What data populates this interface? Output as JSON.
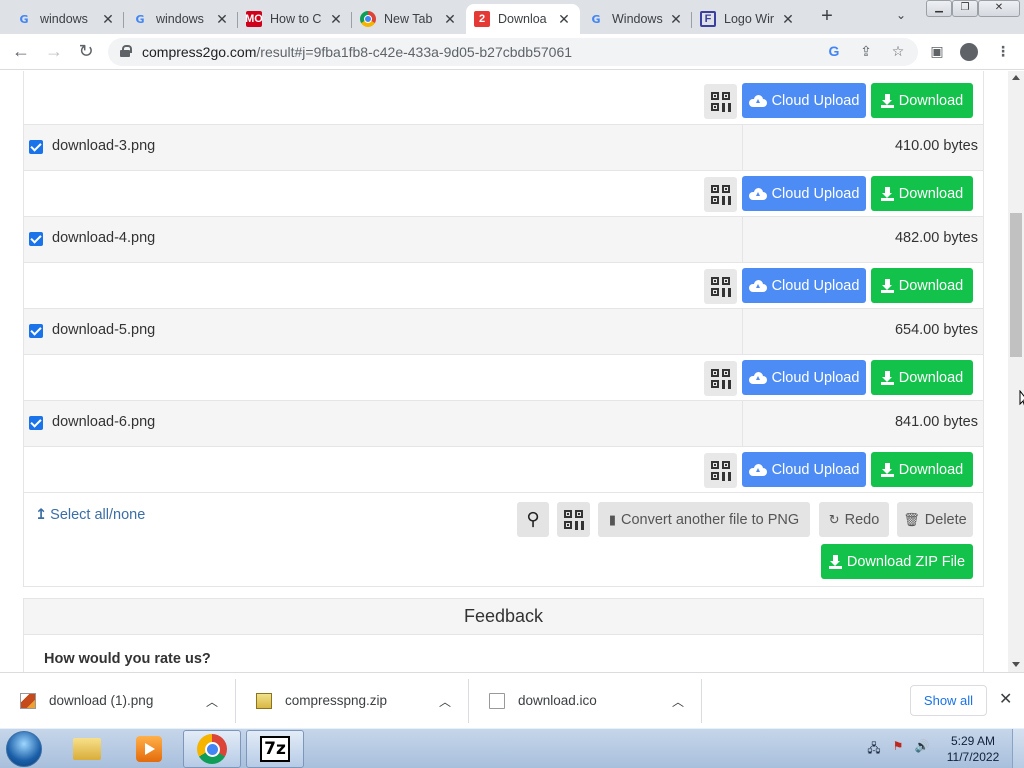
{
  "browser": {
    "tabs": [
      {
        "title": "windows",
        "favicon": "google-g-icon"
      },
      {
        "title": "windows",
        "favicon": "google-g-icon"
      },
      {
        "title": "How to C",
        "favicon": "red-site-icon"
      },
      {
        "title": "New Tab",
        "favicon": "chrome-icon"
      },
      {
        "title": "Downloa",
        "favicon": "compress2go-icon",
        "active": true
      },
      {
        "title": "Windows",
        "favicon": "google-g-icon"
      },
      {
        "title": "Logo Wir",
        "favicon": "logo-site-icon"
      }
    ],
    "new_tab_symbol": "+",
    "url_host": "compress2go.com",
    "url_path": "/result#j=9fba1fb8-c42e-433a-9d05-b27cbdb57061"
  },
  "files": [
    {
      "name": "download-3.png",
      "size": "410.00 bytes",
      "checked": true
    },
    {
      "name": "download-4.png",
      "size": "482.00 bytes",
      "checked": true
    },
    {
      "name": "download-5.png",
      "size": "654.00 bytes",
      "checked": true
    },
    {
      "name": "download-6.png",
      "size": "841.00 bytes",
      "checked": true
    }
  ],
  "actions": {
    "cloud_upload": "Cloud Upload",
    "download": "Download"
  },
  "footer": {
    "select_all": "Select all/none",
    "convert_another": "Convert another file to PNG",
    "redo": "Redo",
    "delete": "Delete",
    "download_zip": "Download ZIP File"
  },
  "feedback": {
    "title": "Feedback",
    "question": "How would you rate us?"
  },
  "downloads_shelf": {
    "items": [
      {
        "name": "download (1).png",
        "icon": "png-file-icon"
      },
      {
        "name": "compresspng.zip",
        "icon": "zip-file-icon"
      },
      {
        "name": "download.ico",
        "icon": "blank-file-icon"
      }
    ],
    "show_all": "Show all"
  },
  "taskbar": {
    "time": "5:29 AM",
    "date": "11/7/2022",
    "apps": [
      "file-explorer",
      "media-player",
      "chrome",
      "7-zip"
    ]
  },
  "colors": {
    "cloud_upload_bg": "#4d8cf5",
    "download_bg": "#13c24a",
    "checkbox": "#1a73e8"
  }
}
